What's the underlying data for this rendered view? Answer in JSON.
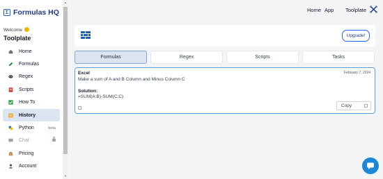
{
  "app": {
    "logo_text": "Formulas HQ",
    "welcome": "Welcome",
    "brand": "Toolplate"
  },
  "sidebar": {
    "items": [
      {
        "label": "Home",
        "icon": "home-icon"
      },
      {
        "label": "Formulas",
        "icon": "pencil-icon"
      },
      {
        "label": "Regex",
        "icon": "mask-icon"
      },
      {
        "label": "Scripts",
        "icon": "script-icon"
      },
      {
        "label": "How To",
        "icon": "checkbox-icon"
      },
      {
        "label": "History",
        "icon": "history-icon",
        "active": true
      },
      {
        "label": "Python",
        "icon": "python-icon",
        "extra": "beta"
      },
      {
        "label": "Chat",
        "icon": "chat-icon",
        "disabled": true
      },
      {
        "label": "Pricing",
        "icon": "money-icon"
      },
      {
        "label": "Account",
        "icon": "account-icon"
      }
    ]
  },
  "topnav": {
    "home": "Home",
    "app": "App",
    "toolplate": "Toolplate"
  },
  "header": {
    "upgrade_label": "Upgrade!"
  },
  "tabs": [
    "Formulas",
    "Regex",
    "Scripts",
    "Tasks"
  ],
  "result": {
    "category": "Excel",
    "date": "February 7, 2024",
    "prompt": "Make a sum of A and B Column and Minus Column C",
    "solution_label": "Solution:",
    "formula": "=SUM(A:B)-SUM(C:C)",
    "copy_label": "Copy"
  },
  "colors": {
    "accent": "#1e5fb3",
    "active_bg": "#dbe5f2",
    "chat": "#1e88d8"
  }
}
